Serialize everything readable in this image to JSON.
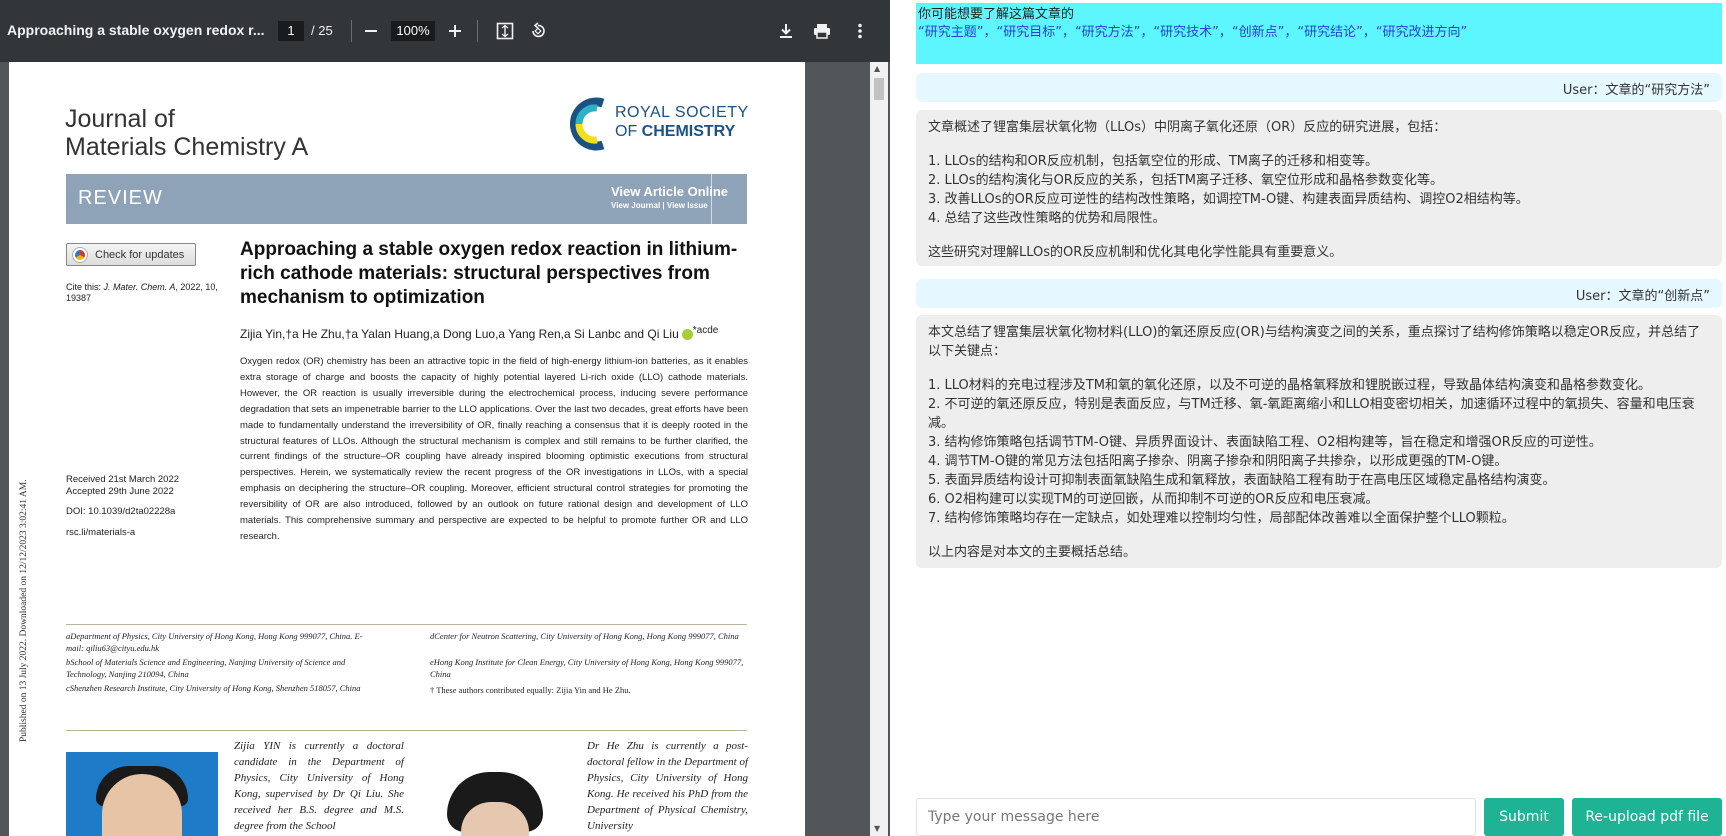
{
  "viewer": {
    "doc_title": "Approaching a stable oxygen redox r...",
    "page_current": "1",
    "page_total": "/ 25",
    "zoom": "100%",
    "icons": [
      "minus-icon",
      "plus-icon",
      "fit-page-icon",
      "rotate-icon",
      "download-icon",
      "print-icon",
      "more-vertical-icon"
    ]
  },
  "pdf": {
    "journal_line1": "Journal of",
    "journal_line2": "Materials Chemistry A",
    "rsc_line1": "ROYAL SOCIETY",
    "rsc_line2_prefix": "OF ",
    "rsc_line2_bold": "CHEMISTRY",
    "review_label": "REVIEW",
    "view_online": "View Article Online",
    "view_sub": "View Journal | View Issue",
    "check_updates": "Check for updates",
    "cite_prefix": "Cite this: ",
    "cite_journal": "J. Mater. Chem. A",
    "cite_rest": ", 2022, 10, 19387",
    "title": "Approaching a stable oxygen redox reaction in lithium-rich cathode materials: structural perspectives from mechanism to optimization",
    "authors": "Zijia Yin,†a He Zhu,†a Yalan Huang,a Dong Luo,a Yang Ren,a Si Lanbc and Qi Liu",
    "authors_tail": "*acde",
    "abstract": "Oxygen redox (OR) chemistry has been an attractive topic in the field of high-energy lithium-ion batteries, as it enables extra storage of charge and boosts the capacity of highly potential layered Li-rich oxide (LLO) cathode materials. However, the OR reaction is usually irreversible during the electrochemical process, inducing severe performance degradation that sets an impenetrable barrier to the LLO applications. Over the last two decades, great efforts have been made to fundamentally understand the irreversibility of OR, finally reaching a consensus that it is deeply rooted in the structural features of LLOs. Although the structural mechanism is complex and still remains to be further clarified, the current findings of the structure–OR coupling have already inspired blooming optimistic executions from structural perspectives. Herein, we systematically review the recent progress of the OR investigations in LLOs, with a special emphasis on deciphering the structure–OR coupling. Moreover, efficient structural control strategies for promoting the reversibility of OR are also introduced, followed by an outlook on future rational design and development of LLO materials. This comprehensive summary and perspective are expected to be helpful to promote further OR and LLO research.",
    "received": "Received 21st March 2022",
    "accepted": "Accepted 29th June 2022",
    "doi": "DOI: 10.1039/d2ta02228a",
    "site": "rsc.li/materials-a",
    "side_note": "Published on 13 July 2022. Downloaded on 12/12/2023 3:02:41 AM.",
    "aff_left": [
      "aDepartment of Physics, City University of Hong Kong, Hong Kong 999077, China. E-mail: qiliu63@cityu.edu.hk",
      "bSchool of Materials Science and Engineering, Nanjing University of Science and Technology, Nanjing 210094, China",
      "cShenzhen Research Institute, City University of Hong Kong, Shenzhen 518057, China"
    ],
    "aff_right": [
      "dCenter for Neutron Scattering, City University of Hong Kong, Hong Kong 999077, China",
      "eHong Kong Institute for Clean Energy, City University of Hong Kong, Hong Kong 999077, China",
      "† These authors contributed equally: Zijia Yin and He Zhu."
    ],
    "bio1": "Zijia YIN is currently a doctoral candidate in the Department of Physics, City University of Hong Kong, supervised by Dr Qi Liu. She received her B.S. degree and M.S. degree from the School",
    "bio2": "Dr He Zhu is currently a post-doctoral fellow in the Department of Physics, City University of Hong Kong. He received his PhD from the Department of Physical Chemistry, University"
  },
  "chat": {
    "suggest_line1": "你可能想要了解这篇文章的",
    "suggest_line2": "“研究主题”，“研究目标”，“研究方法”，“研究技术”，“创新点”，“研究结论”，“研究改进方向”",
    "user1": "User：文章的“研究方法”",
    "bot1": [
      "文章概述了锂富集层状氧化物（LLOs）中阴离子氧化还原（OR）反应的研究进展，包括：",
      "",
      "1. LLOs的结构和OR反应机制，包括氧空位的形成、TM离子的迁移和相变等。",
      "2. LLOs的结构演化与OR反应的关系，包括TM离子迁移、氧空位形成和晶格参数变化等。",
      "3. 改善LLOs的OR反应可逆性的结构改性策略，如调控TM-O键、构建表面异质结构、调控O2相结构等。",
      "4. 总结了这些改性策略的优势和局限性。",
      "",
      "这些研究对理解LLOs的OR反应机制和优化其电化学性能具有重要意义。"
    ],
    "user2": "User：文章的“创新点”",
    "bot2": [
      "本文总结了锂富集层状氧化物材料(LLO)的氧还原反应(OR)与结构演变之间的关系，重点探讨了结构修饰策略以稳定OR反应，并总结了以下关键点：",
      "",
      "1. LLO材料的充电过程涉及TM和氧的氧化还原，以及不可逆的晶格氧释放和锂脱嵌过程，导致晶体结构演变和晶格参数变化。",
      "2. 不可逆的氧还原反应，特别是表面反应，与TM迁移、氧-氧距离缩小和LLO相变密切相关，加速循环过程中的氧损失、容量和电压衰减。",
      "3. 结构修饰策略包括调节TM-O键、异质界面设计、表面缺陷工程、O2相构建等，旨在稳定和增强OR反应的可逆性。",
      "4. 调节TM-O键的常见方法包括阳离子掺杂、阴离子掺杂和阴阳离子共掺杂，以形成更强的TM-O键。",
      "5. 表面异质结构设计可抑制表面氧缺陷生成和氧释放，表面缺陷工程有助于在高电压区域稳定晶格结构演变。",
      "6. O2相构建可以实现TM的可逆回嵌，从而抑制不可逆的OR反应和电压衰减。",
      "7. 结构修饰策略均存在一定缺点，如处理难以控制均匀性，局部配体改善难以全面保护整个LLO颗粒。",
      "",
      "以上内容是对本文的主要概括总结。"
    ],
    "input_placeholder": "Type your message here",
    "submit_label": "Submit",
    "reupload_label": "Re-upload pdf file"
  },
  "colors": {
    "toolbar": "#323639",
    "review_bar": "#8fa3b8",
    "suggest_bg": "#5df6ff",
    "user_bg": "#e6f8ff",
    "bot_bg": "#eeeeee",
    "button": "#1db394"
  }
}
